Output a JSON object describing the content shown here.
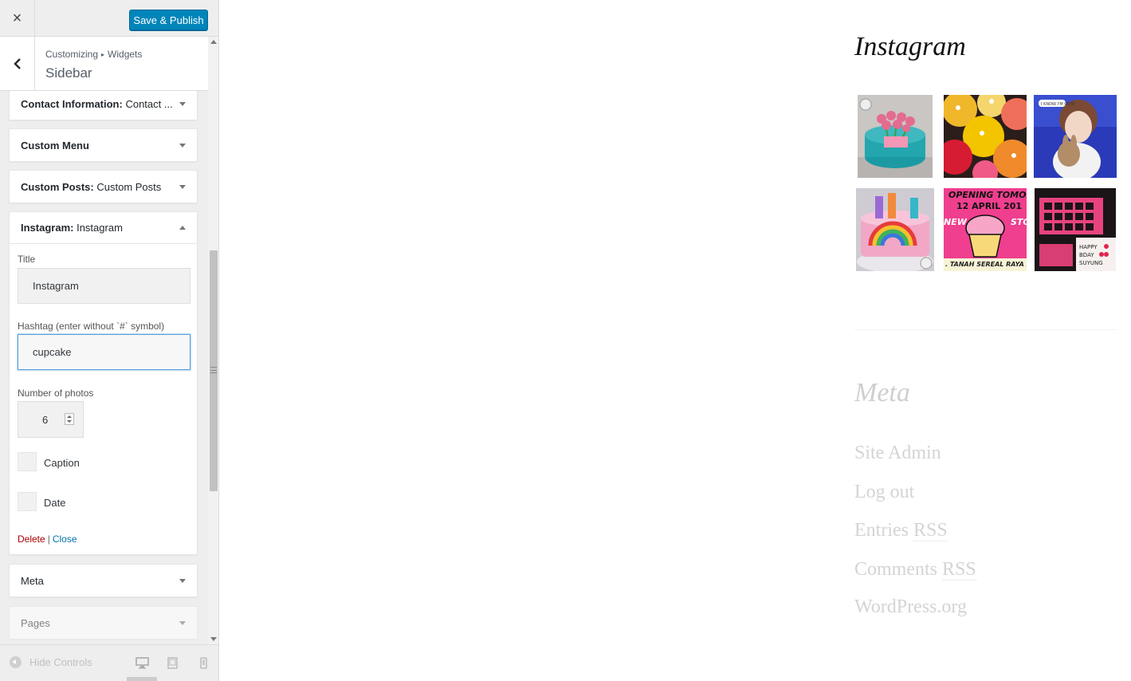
{
  "topbar": {
    "close_label": "×",
    "save_label": "Save & Publish"
  },
  "section": {
    "crumb_root": "Customizing",
    "crumb_sep": "▸",
    "crumb_child": "Widgets",
    "title": "Sidebar"
  },
  "widgets": [
    {
      "name": "Contact Information:",
      "title": "Contact ..."
    },
    {
      "name": "Custom Menu",
      "title": ""
    },
    {
      "name": "Custom Posts:",
      "title": "Custom Posts"
    },
    {
      "name": "Instagram:",
      "title": "Instagram"
    },
    {
      "name": "Meta",
      "title": ""
    },
    {
      "name": "Pages",
      "title": ""
    }
  ],
  "instagram_form": {
    "title_label": "Title",
    "title_value": "Instagram",
    "hashtag_label": "Hashtag (enter without `#` symbol)",
    "hashtag_value": "cupcake",
    "photos_label": "Number of photos",
    "photos_value": "6",
    "caption_label": "Caption",
    "date_label": "Date",
    "delete_label": "Delete",
    "divider": "|",
    "close_label": "Close"
  },
  "footer": {
    "hide_controls": "Hide Controls"
  },
  "preview": {
    "instagram_title": "Instagram",
    "photos": [
      {
        "icon": "teal-tulip-cake-photo"
      },
      {
        "icon": "cupcakes-photo"
      },
      {
        "icon": "person-with-plush-photo"
      },
      {
        "icon": "rainbow-birthday-cake-photo"
      },
      {
        "icon": "cupcake-store-opening-poster-photo"
      },
      {
        "icon": "chocolate-box-photo"
      }
    ],
    "meta_title": "Meta",
    "meta_links": [
      {
        "text": "Site Admin",
        "abbr": ""
      },
      {
        "text": "Log out",
        "abbr": ""
      },
      {
        "text": "Entries ",
        "abbr": "RSS"
      },
      {
        "text": "Comments ",
        "abbr": "RSS"
      },
      {
        "text": "WordPress.org",
        "abbr": ""
      }
    ]
  },
  "colors": {
    "primary_button": "#0085ba",
    "panel_bg": "#eeeeee",
    "delete_link": "#aa0000",
    "close_link": "#0073aa",
    "focus_border": "#5b9dd9"
  }
}
